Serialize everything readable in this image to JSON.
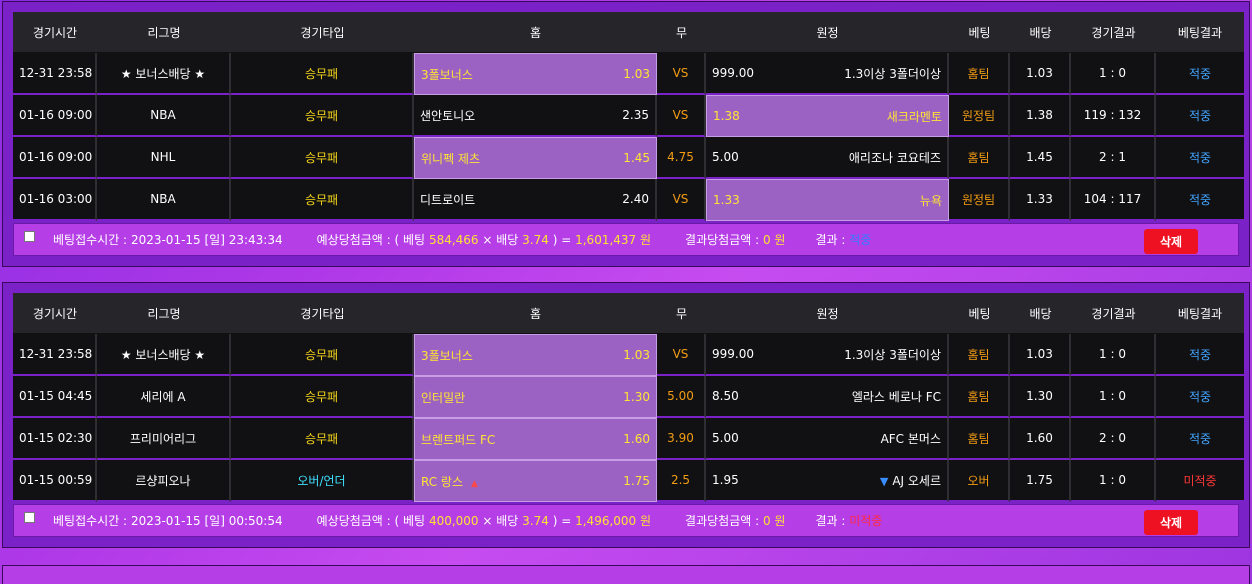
{
  "headers": [
    "경기시간",
    "리그명",
    "경기타입",
    "홈",
    "무",
    "원정",
    "베팅",
    "배당",
    "경기결과",
    "베팅결과"
  ],
  "slips": [
    {
      "rows": [
        {
          "time": "12-31 23:58",
          "league": "★ 보너스배당 ★",
          "type": "승무패",
          "type_color": "yellow",
          "home": "3폴보너스",
          "home_odd": "1.03",
          "draw": "VS",
          "away_odd": "999.00",
          "away": "1.3이상 3폴더이상",
          "selected": "home",
          "pick": "홈팀",
          "odd": "1.03",
          "score": "1 : 0",
          "result": "적중",
          "result_state": "ok"
        },
        {
          "time": "01-16 09:00",
          "league": "NBA",
          "type": "승무패",
          "type_color": "yellow",
          "home": "샌안토니오",
          "home_odd": "2.35",
          "draw": "VS",
          "away_odd": "1.38",
          "away": "새크라멘토",
          "selected": "away",
          "pick": "원정팀",
          "odd": "1.38",
          "score": "119 : 132",
          "result": "적중",
          "result_state": "ok"
        },
        {
          "time": "01-16 09:00",
          "league": "NHL",
          "type": "승무패",
          "type_color": "yellow",
          "home": "위니펙 제츠",
          "home_odd": "1.45",
          "draw": "4.75",
          "away_odd": "5.00",
          "away": "애리조나 코요테즈",
          "selected": "home",
          "pick": "홈팀",
          "odd": "1.45",
          "score": "2 : 1",
          "result": "적중",
          "result_state": "ok"
        },
        {
          "time": "01-16 03:00",
          "league": "NBA",
          "type": "승무패",
          "type_color": "yellow",
          "home": "디트로이트",
          "home_odd": "2.40",
          "draw": "VS",
          "away_odd": "1.33",
          "away": "뉴욕",
          "selected": "away",
          "pick": "원정팀",
          "odd": "1.33",
          "score": "104 : 117",
          "result": "적중",
          "result_state": "ok"
        }
      ],
      "summary": {
        "time_label": "베팅접수시간 :",
        "time_value": "2023-01-15 [일] 23:43:34",
        "expected_label": "예상당첨금액 : ( 베팅",
        "bet_amount": "584,466",
        "times": "× 배당",
        "total_odd": "3.74",
        "equals": ") =",
        "expected_amount": "1,601,437 원",
        "result_amount_label": "결과당첨금액 :",
        "result_amount": "0 원",
        "result_label": "결과 :",
        "result_value": "적중",
        "result_state": "ok",
        "delete_label": "삭제"
      }
    },
    {
      "rows": [
        {
          "time": "12-31 23:58",
          "league": "★ 보너스배당 ★",
          "type": "승무패",
          "type_color": "yellow",
          "home": "3폴보너스",
          "home_odd": "1.03",
          "draw": "VS",
          "away_odd": "999.00",
          "away": "1.3이상 3폴더이상",
          "selected": "home",
          "pick": "홈팀",
          "odd": "1.03",
          "score": "1 : 0",
          "result": "적중",
          "result_state": "ok"
        },
        {
          "time": "01-15 04:45",
          "league": "세리에 A",
          "type": "승무패",
          "type_color": "yellow",
          "home": "인터밀란",
          "home_odd": "1.30",
          "draw": "5.00",
          "away_odd": "8.50",
          "away": "엘라스 베로나 FC",
          "selected": "home",
          "pick": "홈팀",
          "odd": "1.30",
          "score": "1 : 0",
          "result": "적중",
          "result_state": "ok"
        },
        {
          "time": "01-15 02:30",
          "league": "프리미어리그",
          "type": "승무패",
          "type_color": "yellow",
          "home": "브렌트퍼드 FC",
          "home_odd": "1.60",
          "draw": "3.90",
          "away_odd": "5.00",
          "away": "AFC 본머스",
          "selected": "home",
          "pick": "홈팀",
          "odd": "1.60",
          "score": "2 : 0",
          "result": "적중",
          "result_state": "ok"
        },
        {
          "time": "01-15 00:59",
          "league": "르샹피오나",
          "type": "오버/언더",
          "type_color": "cyan",
          "home": "RC 랑스",
          "home_odd": "1.75",
          "draw": "2.5",
          "away_odd": "1.95",
          "away": "AJ 오세르",
          "selected": "home",
          "arrows": true,
          "pick": "오버",
          "odd": "1.75",
          "score": "1 : 0",
          "result": "미적중",
          "result_state": "fail"
        }
      ],
      "summary": {
        "time_label": "베팅접수시간 :",
        "time_value": "2023-01-15 [일] 00:50:54",
        "expected_label": "예상당첨금액 : ( 베팅",
        "bet_amount": "400,000",
        "times": "× 배당",
        "total_odd": "3.74",
        "equals": ") =",
        "expected_amount": "1,496,000 원",
        "result_amount_label": "결과당첨금액 :",
        "result_amount": "0 원",
        "result_label": "결과 :",
        "result_value": "미적중",
        "result_state": "fail",
        "delete_label": "삭제"
      }
    }
  ]
}
